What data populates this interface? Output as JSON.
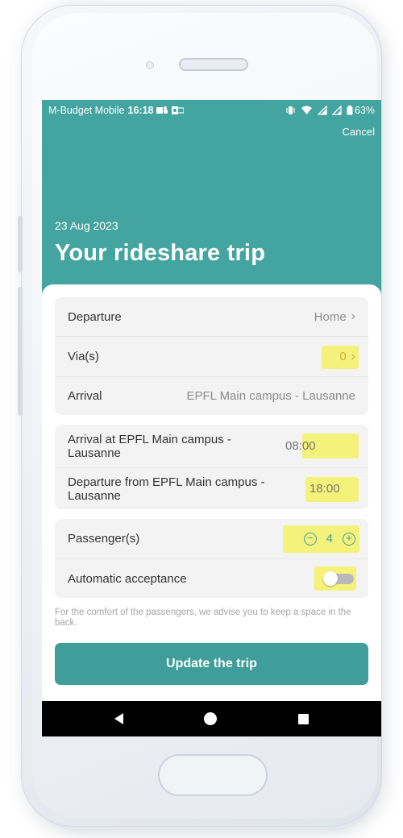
{
  "status_bar": {
    "carrier": "M-Budget Mobile",
    "time": "16:18",
    "battery": "63%",
    "icons": [
      "teams-icon",
      "outlook-icon",
      "vibrate-icon",
      "wifi-icon",
      "signal-icon",
      "signal-icon",
      "battery-icon"
    ]
  },
  "header": {
    "cancel_label": "Cancel",
    "date": "23 Aug 2023",
    "title": "Your rideshare trip"
  },
  "route": {
    "departure_label": "Departure",
    "departure_value": "Home",
    "via_label": "Via(s)",
    "via_value": "0",
    "arrival_label": "Arrival",
    "arrival_value": "EPFL Main campus - Lausanne"
  },
  "schedule": {
    "arrival_label": "Arrival at EPFL Main campus - Lausanne",
    "arrival_time": "08:00",
    "departure_label": "Departure from EPFL Main campus - Lausanne",
    "departure_time": "18:00"
  },
  "passengers": {
    "label": "Passenger(s)",
    "count": "4",
    "auto_accept_label": "Automatic acceptance",
    "auto_accept_enabled": false
  },
  "hint": "For the comfort of the passengers, we advise you to keep a space in the back.",
  "actions": {
    "update_label": "Update the trip"
  },
  "colors": {
    "header_teal": "#44a4a0",
    "button_teal": "#3f9e99",
    "highlight": "#f4f27a"
  }
}
